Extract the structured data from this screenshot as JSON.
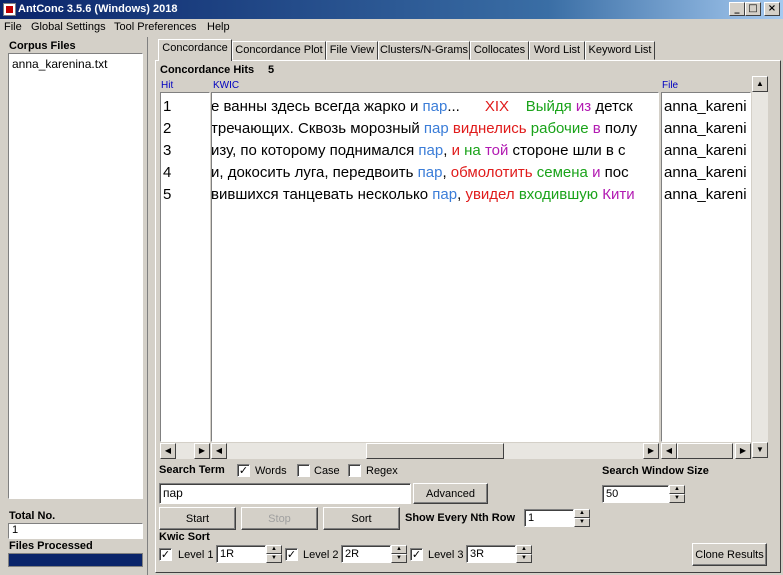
{
  "window": {
    "title": "AntConc 3.5.6 (Windows) 2018",
    "controls": [
      "_",
      "□",
      "×"
    ]
  },
  "menu": [
    "File",
    "Global Settings",
    "Tool Preferences",
    "Help"
  ],
  "left_panel": {
    "heading": "Corpus Files",
    "files": [
      "anna_karenina.txt"
    ],
    "total_label": "Total No.",
    "total_value": "1",
    "processed_label": "Files Processed"
  },
  "tabs": [
    "Concordance",
    "Concordance Plot",
    "File View",
    "Clusters/N-Grams",
    "Collocates",
    "Word List",
    "Keyword List"
  ],
  "active_tab": "Concordance",
  "hits": {
    "label": "Concordance Hits",
    "count": "5",
    "col_hit": "Hit",
    "col_kwic": "KWIC",
    "col_file": "File"
  },
  "colors": {
    "keyword": "#3b7dd8",
    "r1": "#e01b1b",
    "r2": "#1aa31a",
    "r3": "#b21ab2",
    "header_link": "#0000c0"
  },
  "rows": [
    {
      "hit": "1",
      "left": "е ванны здесь всегда жарко и ",
      "kw": "пар",
      "after": "...      ",
      "r1": "XIX",
      "s1": "    ",
      "r2": "Выйдя",
      "s2": " ",
      "r3": "из",
      "rest": " детск",
      "file": "anna_kareni"
    },
    {
      "hit": "2",
      "left": "тречающих. Сквозь морозный ",
      "kw": "пар",
      "after": " ",
      "r1": "виднелись",
      "s1": " ",
      "r2": "рабочие",
      "s2": " ",
      "r3": "в",
      "rest": " полу",
      "file": "anna_kareni"
    },
    {
      "hit": "3",
      "left": "изу, по которому поднимался ",
      "kw": "пар",
      "after": ", ",
      "r1": "и",
      "s1": " ",
      "r2": "на",
      "s2": " ",
      "r3": "той",
      "rest": " стороне шли в с",
      "file": "anna_kareni"
    },
    {
      "hit": "4",
      "left": "и, докосить луга, передвоить ",
      "kw": "пар",
      "after": ", ",
      "r1": "обмолотить",
      "s1": " ",
      "r2": "семена",
      "s2": " ",
      "r3": "и",
      "rest": " пос",
      "file": "anna_kareni"
    },
    {
      "hit": "5",
      "left": "вившихся танцевать несколько ",
      "kw": "пар",
      "after": ", ",
      "r1": "увидел",
      "s1": " ",
      "r2": "входившую",
      "s2": " ",
      "r3": "Кити",
      "rest": "",
      "file": "anna_kareni"
    }
  ],
  "search": {
    "term_label": "Search Term",
    "words_label": "Words",
    "case_label": "Case",
    "regex_label": "Regex",
    "words_checked": true,
    "case_checked": false,
    "regex_checked": false,
    "term_value": "пар",
    "advanced_label": "Advanced",
    "start_label": "Start",
    "stop_label": "Stop",
    "sort_label": "Sort",
    "nth_label": "Show Every Nth Row",
    "nth_value": "1",
    "window_label": "Search Window Size",
    "window_value": "50"
  },
  "kwic_sort": {
    "label": "Kwic Sort",
    "level1_label": "Level 1",
    "level1_value": "1R",
    "level2_label": "Level 2",
    "level2_value": "2R",
    "level3_label": "Level 3",
    "level3_value": "3R",
    "clone_label": "Clone Results"
  }
}
